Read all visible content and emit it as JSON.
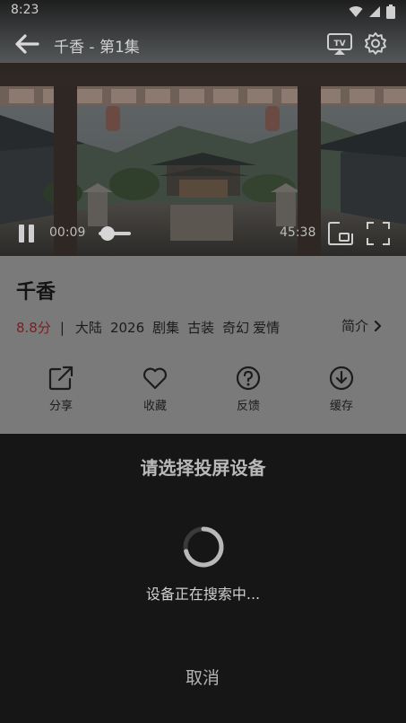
{
  "status_bar": {
    "time": "8:23"
  },
  "player": {
    "title": "千香 - 第1集",
    "current_time": "00:09",
    "total_time": "45:38",
    "progress": 0.01
  },
  "show": {
    "title": "千香",
    "rating": "8.8分",
    "separator": "|",
    "tags": [
      "大陆",
      "2026",
      "剧集",
      "古装",
      "奇幻",
      "爱情"
    ],
    "intro_label": "简介"
  },
  "actions": [
    {
      "label": "分享",
      "icon": "share-icon"
    },
    {
      "label": "收藏",
      "icon": "heart-icon"
    },
    {
      "label": "反馈",
      "icon": "help-icon"
    },
    {
      "label": "缓存",
      "icon": "download-icon"
    }
  ],
  "cast_dialog": {
    "title": "请选择投屏设备",
    "status": "设备正在搜索中...",
    "cancel_label": "取消"
  },
  "colors": {
    "rating": "#7c1f1f",
    "sheet_bg": "#161616",
    "info_bg": "#7a7a7a"
  }
}
